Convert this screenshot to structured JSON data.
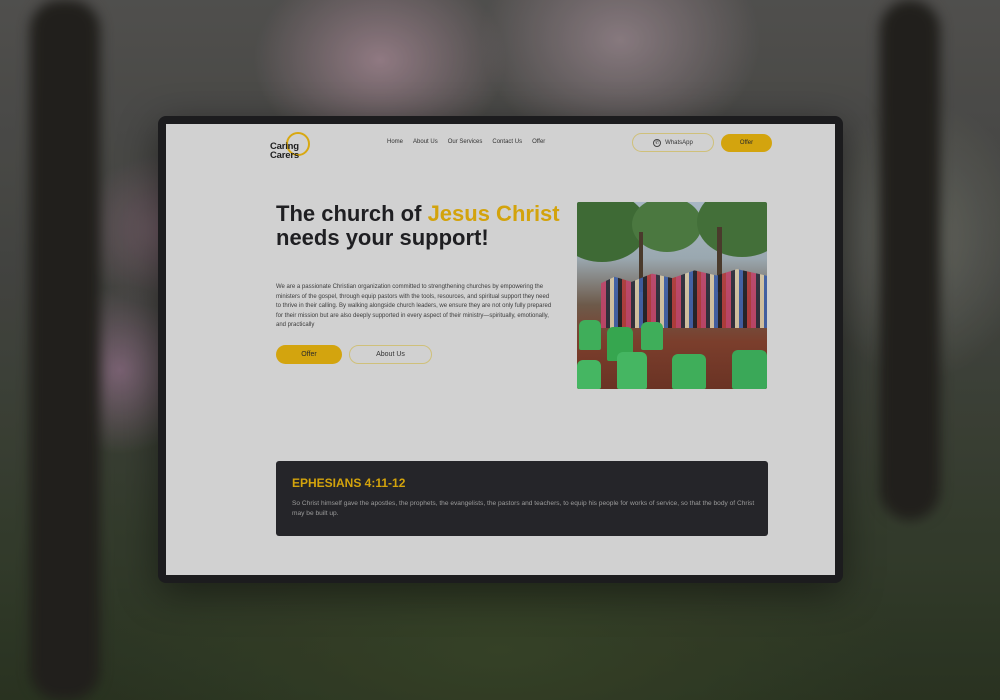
{
  "site": {
    "logo_text_line1": "Caring",
    "logo_text_line2": "Carers"
  },
  "nav": {
    "items": [
      "Home",
      "About Us",
      "Our Services",
      "Contact Us",
      "Offer"
    ]
  },
  "header": {
    "whatsapp_label": "WhatsApp",
    "offer_label": "Offer"
  },
  "hero": {
    "title_part1": "The church of ",
    "title_accent": "Jesus Christ",
    "title_part2": " needs your support!",
    "description": "We are a passionate Christian organization committed to strengthening churches by empowering the ministers of the gospel, through equip pastors with the tools, resources, and spiritual support they need to thrive in their calling. By walking alongside church leaders, we ensure they are not only fully prepared for their mission but are also deeply supported in every aspect of their ministry—spiritually, emotionally, and practically",
    "offer_button": "Offer",
    "about_button": "About Us"
  },
  "quote": {
    "reference": "EPHESIANS 4:11-12",
    "text": "So Christ himself gave the apostles, the prophets, the evangelists, the pastors and teachers, to equip his people for works of service, so that the body of Christ may be built up."
  },
  "colors": {
    "accent": "#d3a30c",
    "dark_box": "#252529",
    "page_bg": "#d1d1d1"
  },
  "icons": {
    "whatsapp": "whatsapp-icon",
    "logo": "logo-icon"
  }
}
